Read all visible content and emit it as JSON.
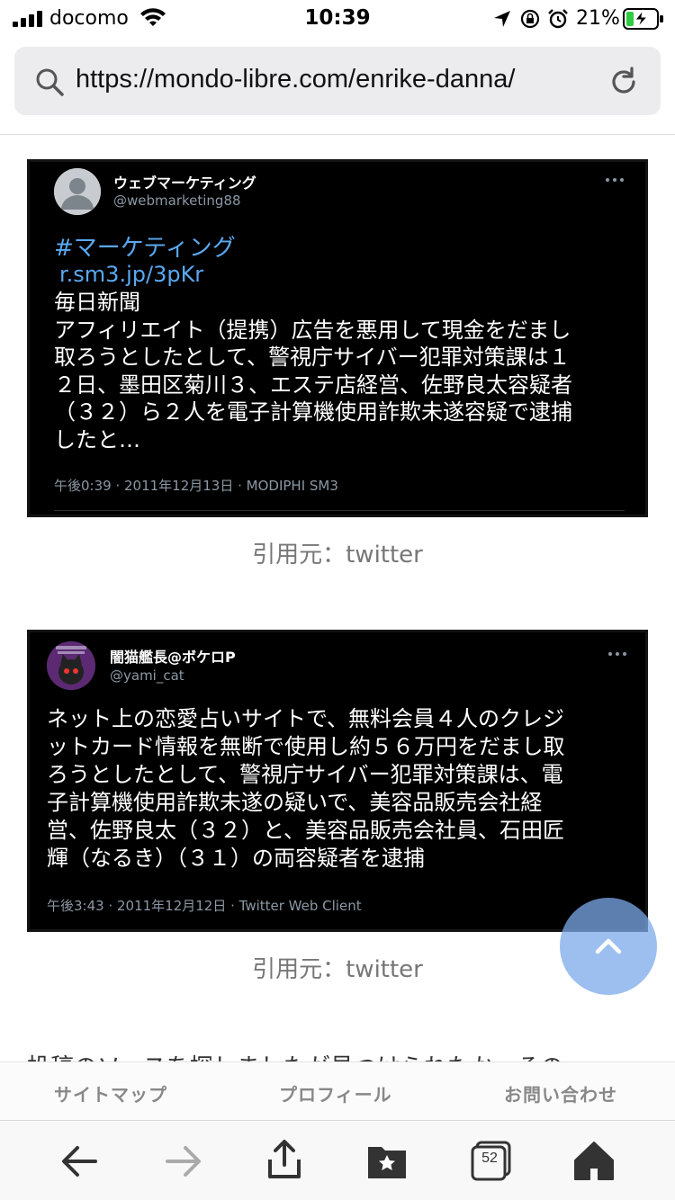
{
  "status_bar": {
    "carrier": "docomo",
    "time": "10:39",
    "battery_percent": "21%"
  },
  "browser": {
    "url": "https://mondo-libre.com/enrike-danna/",
    "tabs_count": "52"
  },
  "tweets": [
    {
      "display_name": "ウェブマーケティング",
      "handle": "@webmarketing88",
      "hashtag": "#マーケティング",
      "link": "r.sm3.jp/3pKr",
      "lines": [
        "毎日新聞",
        "アフィリエイト（提携）広告を悪用して現金をだまし",
        "取ろうとしたとして、警視庁サイバー犯罪対策課は１",
        "２日、墨田区菊川３、エステ店経営、佐野良太容疑者",
        "（３２）ら２人を電子計算機使用詐欺未遂容疑で逮捕",
        "したと…"
      ],
      "meta": "午後0:39 · 2011年12月13日 · MODIPHI SM3"
    },
    {
      "display_name": "闇猫艦長@ボケロP",
      "handle": "@yami_cat",
      "lines": [
        "ネット上の恋愛占いサイトで、無料会員４人のクレジ",
        "ットカード情報を無断で使用し約５６万円をだまし取",
        "ろうとしたとして、警視庁サイバー犯罪対策課は、電",
        "子計算機使用詐欺未遂の疑いで、美容品販売会社経",
        "営、佐野良太（３２）と、美容品販売会社員、石田匠",
        "輝（なるき）（３１）の両容疑者を逮捕"
      ],
      "meta": "午後3:43 · 2011年12月12日 · Twitter Web Client"
    }
  ],
  "captions": [
    "引用元：twitter",
    "引用元：twitter"
  ],
  "article_text": "投稿のソースを探しましたが見つけられたか、その",
  "footer_nav": [
    "サイトマップ",
    "プロフィール",
    "お問い合わせ"
  ],
  "colors": {
    "link_blue": "#5aa8f0",
    "to_top_blue": "#7caaeb",
    "url_bar_bg": "#ececee"
  },
  "icons": [
    "search-icon",
    "reload-icon",
    "back-arrow-icon",
    "forward-arrow-icon",
    "share-icon",
    "bookmarks-icon",
    "tabs-icon",
    "home-icon",
    "chevron-up-icon"
  ]
}
